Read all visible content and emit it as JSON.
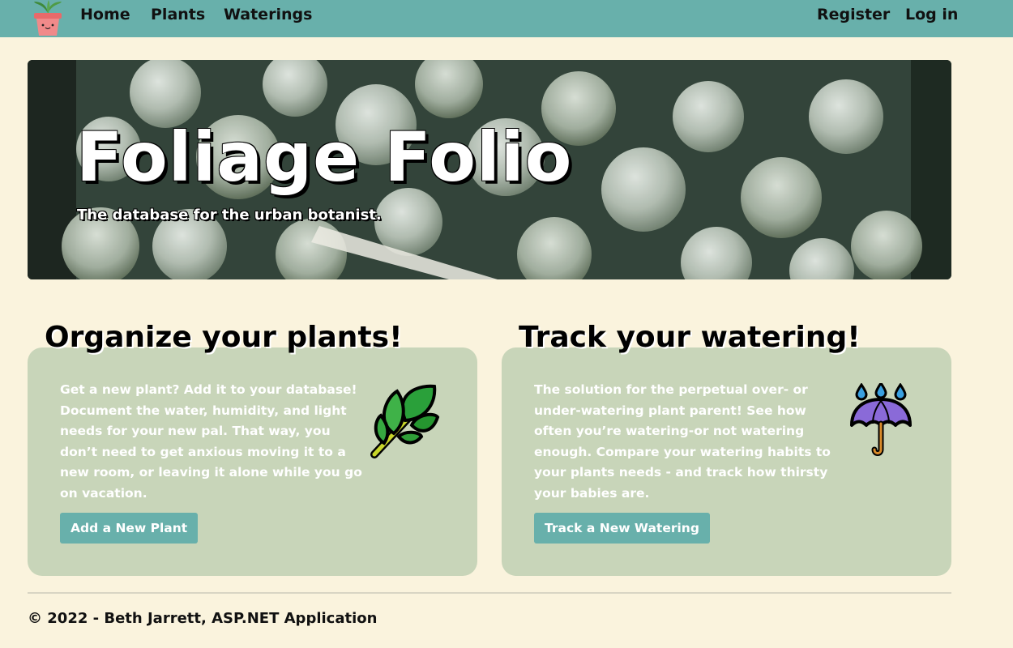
{
  "nav": {
    "logo_icon": "potted-plant-icon",
    "left_links": [
      "Home",
      "Plants",
      "Waterings"
    ],
    "right_links": [
      "Register",
      "Log in"
    ]
  },
  "hero": {
    "title": "Foliage Folio",
    "subtitle": "The database for the urban botanist."
  },
  "cards": {
    "plants": {
      "heading": "Organize your plants!",
      "body": "Get a new plant? Add it to your database! Document the water, humidity, and light needs for your new pal. That way, you don’t need to get anxious moving it to a new room, or leaving it alone while you go on vacation.",
      "button": "Add a New Plant",
      "icon": "herb-icon"
    },
    "water": {
      "heading": "Track your watering!",
      "body": "The solution for the perpetual over- or under-watering plant parent! See how often you’re watering-or not watering enough. Compare your watering habits to your plants needs - and track how thirsty your babies are.",
      "button": "Track a New Watering",
      "icon": "umbrella-rain-icon"
    }
  },
  "footer": {
    "text": "© 2022 - Beth Jarrett, ASP.NET Application"
  },
  "colors": {
    "navbar": "#68B0AB",
    "page_background": "#FAF3DD",
    "card_background": "#C8D5B9",
    "button": "#68B0AB"
  }
}
